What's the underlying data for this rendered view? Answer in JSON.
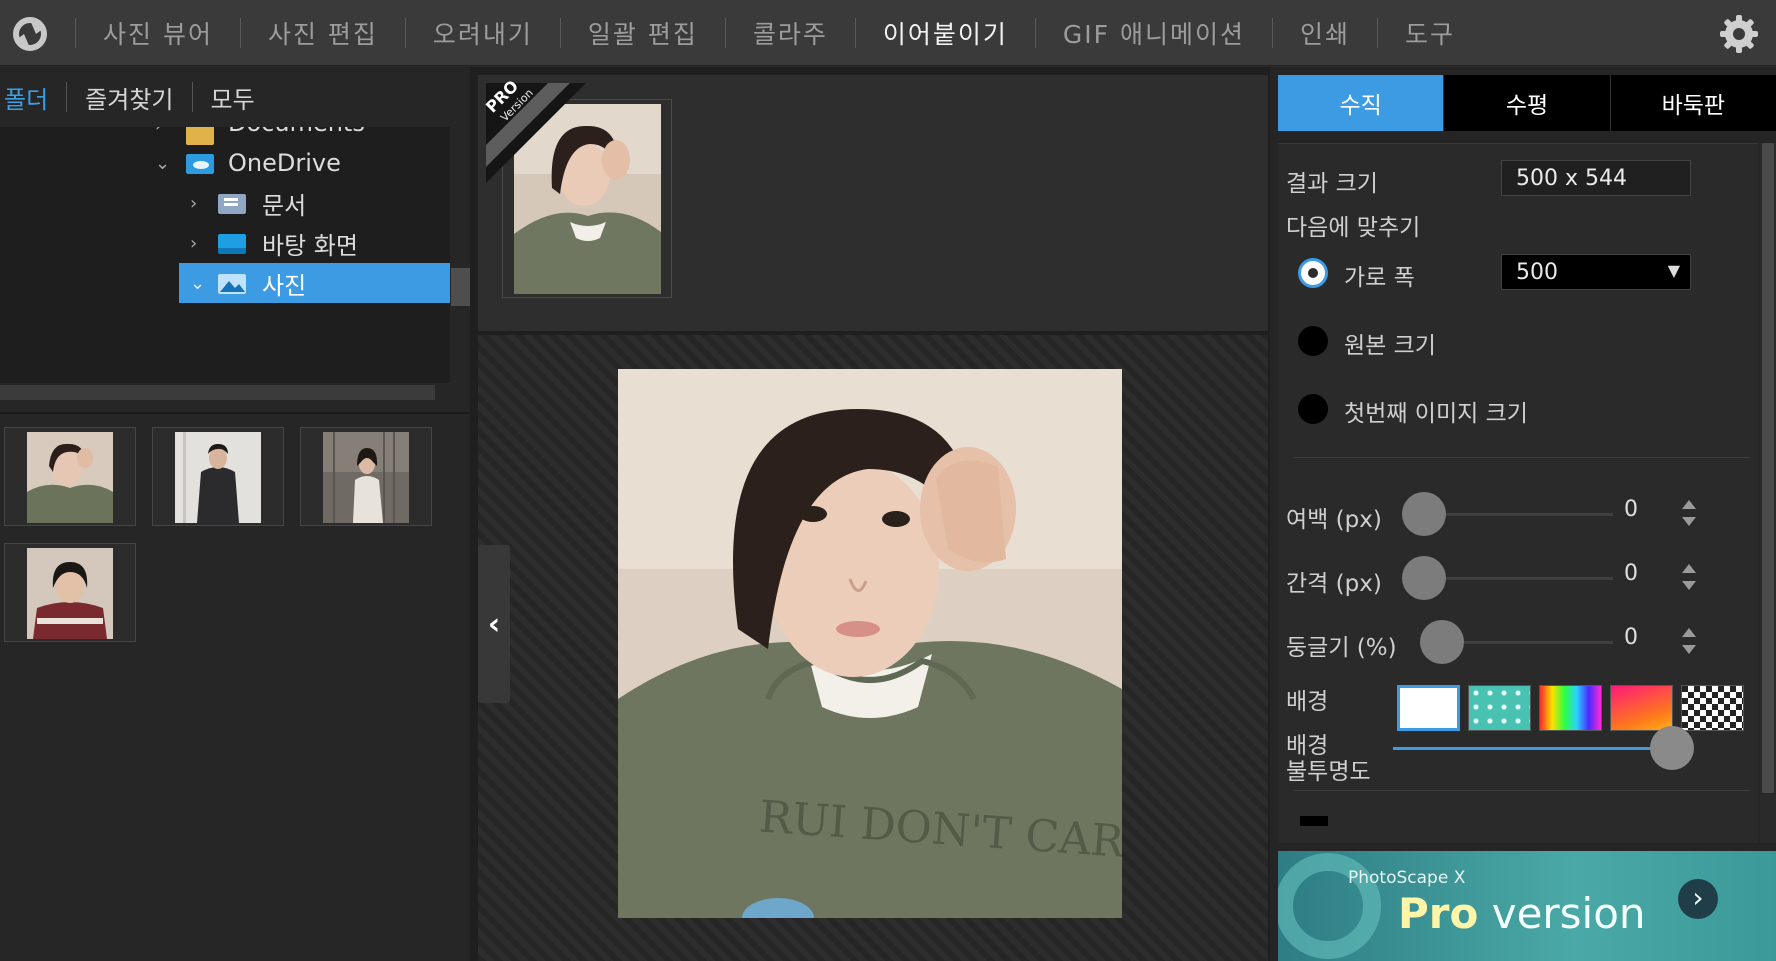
{
  "menu": {
    "items": [
      "사진 뷰어",
      "사진 편집",
      "오려내기",
      "일괄 편집",
      "콜라주",
      "이어붙이기",
      "GIF 애니메이션",
      "인쇄",
      "도구"
    ],
    "active_index": 5
  },
  "left": {
    "tabs": [
      "폴더",
      "즐겨찾기",
      "모두"
    ],
    "active_tab": "폴더",
    "tree": {
      "partial_item": "Documents",
      "onedrive": "OneDrive",
      "docs": "문서",
      "desktop": "바탕 화면",
      "photos": "사진"
    },
    "thumbnail_count": 4
  },
  "center": {
    "badge_pro": "PRO",
    "badge_version": "Version",
    "collapse_glyph": "‹"
  },
  "right": {
    "tabs": [
      "수직",
      "수평",
      "바둑판"
    ],
    "active_tab": "수직",
    "result_size_label": "결과 크기",
    "result_size_value": "500 x 544",
    "fit_label": "다음에 맞추기",
    "fit_options": {
      "width": "가로 폭",
      "original": "원본 크기",
      "first": "첫번째 이미지 크기"
    },
    "fit_selected": "width",
    "width_value": "500",
    "margin_label": "여백 (px)",
    "margin_value": "0",
    "spacing_label": "간격 (px)",
    "spacing_value": "0",
    "round_label": "둥글기 (%)",
    "round_value": "0",
    "background_label": "배경",
    "opacity_label_1": "배경",
    "opacity_label_2": "불투명도",
    "opacity_level": 1.0,
    "selected_background": "white"
  },
  "promo": {
    "small": "PhotoScape X",
    "pro": "Pro",
    "version": " version",
    "arrow": "›"
  },
  "colors": {
    "accent": "#3d9be3",
    "topbar": "#3a3a3a",
    "promo": "#4aa9a6"
  },
  "icons": {
    "logo": "app-logo-icon",
    "settings": "gear-icon"
  }
}
